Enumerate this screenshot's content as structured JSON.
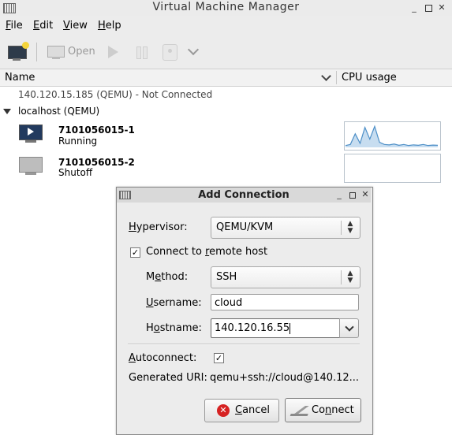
{
  "main_window": {
    "title": "Virtual Machine Manager",
    "menu": [
      {
        "label_u": "F",
        "label_rest": "ile"
      },
      {
        "label_u": "E",
        "label_rest": "dit"
      },
      {
        "label_u": "V",
        "label_rest": "iew"
      },
      {
        "label_u": "H",
        "label_rest": "elp"
      }
    ],
    "toolbar": {
      "open_label": "Open"
    },
    "columns": {
      "name": "Name",
      "cpu": "CPU usage"
    },
    "connections": {
      "remote": "140.120.15.185 (QEMU) - Not Connected",
      "local": "localhost (QEMU)"
    },
    "vms": [
      {
        "name": "7101056015-1",
        "status": "Running",
        "cpu_sparkline": [
          0.05,
          0.1,
          0.6,
          0.15,
          0.9,
          0.35,
          0.95,
          0.2,
          0.1,
          0.08,
          0.12,
          0.06,
          0.1,
          0.05,
          0.08,
          0.06,
          0.1,
          0.05,
          0.07,
          0.06
        ]
      },
      {
        "name": "7101056015-2",
        "status": "Shutoff",
        "cpu_sparkline": []
      }
    ],
    "colors": {
      "sparkline_stroke": "#4d8fc7",
      "sparkline_fill": "#c7ddf0"
    }
  },
  "dialog": {
    "title": "Add Connection",
    "hypervisor": {
      "label_u": "H",
      "label_rest": "ypervisor:",
      "value": "QEMU/KVM"
    },
    "remote": {
      "label_pre": "Connect to ",
      "label_u": "r",
      "label_rest": "emote host",
      "checked": "✓"
    },
    "method": {
      "label_pre": "M",
      "label_u": "e",
      "label_rest": "thod:",
      "value": "SSH"
    },
    "username": {
      "label_u": "U",
      "label_rest": "sername:",
      "value": "cloud"
    },
    "hostname": {
      "label_pre": "H",
      "label_u": "o",
      "label_rest": "stname:",
      "value": "140.120.16.55"
    },
    "autoconnect": {
      "label_u": "A",
      "label_rest": "utoconnect:",
      "checked": "✓"
    },
    "generated_uri": {
      "label": "Generated URI:",
      "value": "qemu+ssh://cloud@140.12..."
    },
    "buttons": {
      "cancel": {
        "label_u": "C",
        "label_rest": "ancel"
      },
      "connect": {
        "label_pre": "Co",
        "label_u": "n",
        "label_rest": "nect"
      }
    }
  }
}
